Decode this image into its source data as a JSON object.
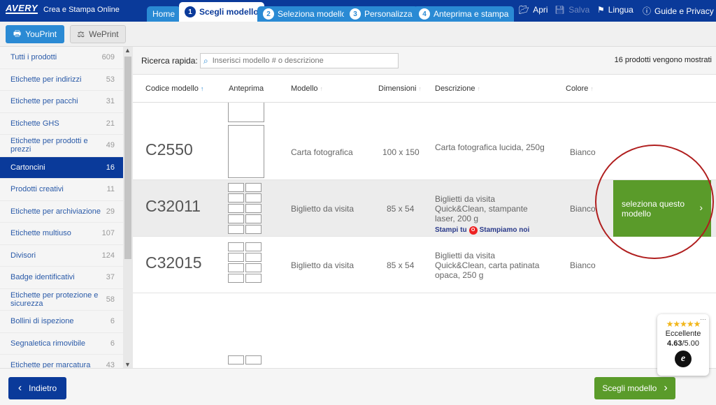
{
  "app": {
    "logo": "AVERY",
    "title": "Crea e Stampa Online"
  },
  "tabs": [
    {
      "label": "Home"
    },
    {
      "num": "1",
      "label": "Scegli modello"
    },
    {
      "num": "2",
      "label": "Seleziona modello"
    },
    {
      "num": "3",
      "label": "Personalizza"
    },
    {
      "num": "4",
      "label": "Anteprima e stampa"
    }
  ],
  "top_actions": {
    "open": "Apri",
    "save": "Salva",
    "language": "Lingua",
    "guide": "Guide e Privacy"
  },
  "modes": {
    "youprint": "YouPrint",
    "weprint": "WePrint"
  },
  "sidebar": {
    "items": [
      {
        "label": "Tutti i prodotti",
        "count": "609"
      },
      {
        "label": "Etichette per indirizzi",
        "count": "53"
      },
      {
        "label": "Etichette per pacchi",
        "count": "31"
      },
      {
        "label": "Etichette GHS",
        "count": "21"
      },
      {
        "label": "Etichette per prodotti e prezzi",
        "count": "49"
      },
      {
        "label": "Cartoncini",
        "count": "16",
        "active": true
      },
      {
        "label": "Prodotti creativi",
        "count": "11"
      },
      {
        "label": "Etichette per archiviazione",
        "count": "29"
      },
      {
        "label": "Etichette multiuso",
        "count": "107"
      },
      {
        "label": "Divisori",
        "count": "124"
      },
      {
        "label": "Badge identificativi",
        "count": "37"
      },
      {
        "label": "Etichette per protezione e sicurezza",
        "count": "58"
      },
      {
        "label": "Bollini di ispezione",
        "count": "6"
      },
      {
        "label": "Segnaletica rimovibile",
        "count": "6"
      },
      {
        "label": "Etichette per marcatura",
        "count": "43"
      }
    ]
  },
  "search": {
    "label": "Ricerca rapida:",
    "placeholder": "Inserisci modello # o descrizione",
    "result_count": "16 prodotti vengono mostrati"
  },
  "table": {
    "headers": {
      "code": "Codice modello",
      "preview": "Anteprima",
      "model": "Modello",
      "dimensions": "Dimensioni",
      "description": "Descrizione",
      "color": "Colore"
    },
    "rows": [
      {
        "code": "C2550",
        "model": "Carta fotografica",
        "dimensions": "100 x 150",
        "description": "Carta fotografica lucida, 250g",
        "color": "Bianco"
      },
      {
        "code": "C32011",
        "model": "Biglietto da visita",
        "dimensions": "85 x 54",
        "description": "Biglietti da visita Quick&Clean, stampante laser, 200 g",
        "color": "Bianco",
        "stampi_tu": "Stampi tu",
        "stampiamo_noi": "Stampiamo noi",
        "o": "O"
      },
      {
        "code": "C32015",
        "model": "Biglietto da visita",
        "dimensions": "85 x 54",
        "description": "Biglietti da visita Quick&Clean, carta patinata opaca, 250 g",
        "color": "Bianco"
      }
    ],
    "select_label": "seleziona questo modello"
  },
  "footer": {
    "back": "Indietro",
    "choose": "Scegli modello"
  },
  "rating": {
    "stars": "★★★★★",
    "label": "Eccellente",
    "score": "4.63",
    "max": "/5.00",
    "badge": "e"
  },
  "colors": {
    "brand_blue": "#0a3a9a",
    "tab_blue": "#2a8ad4",
    "action_green": "#5a9b2a",
    "highlight_red": "#b01e1e"
  }
}
